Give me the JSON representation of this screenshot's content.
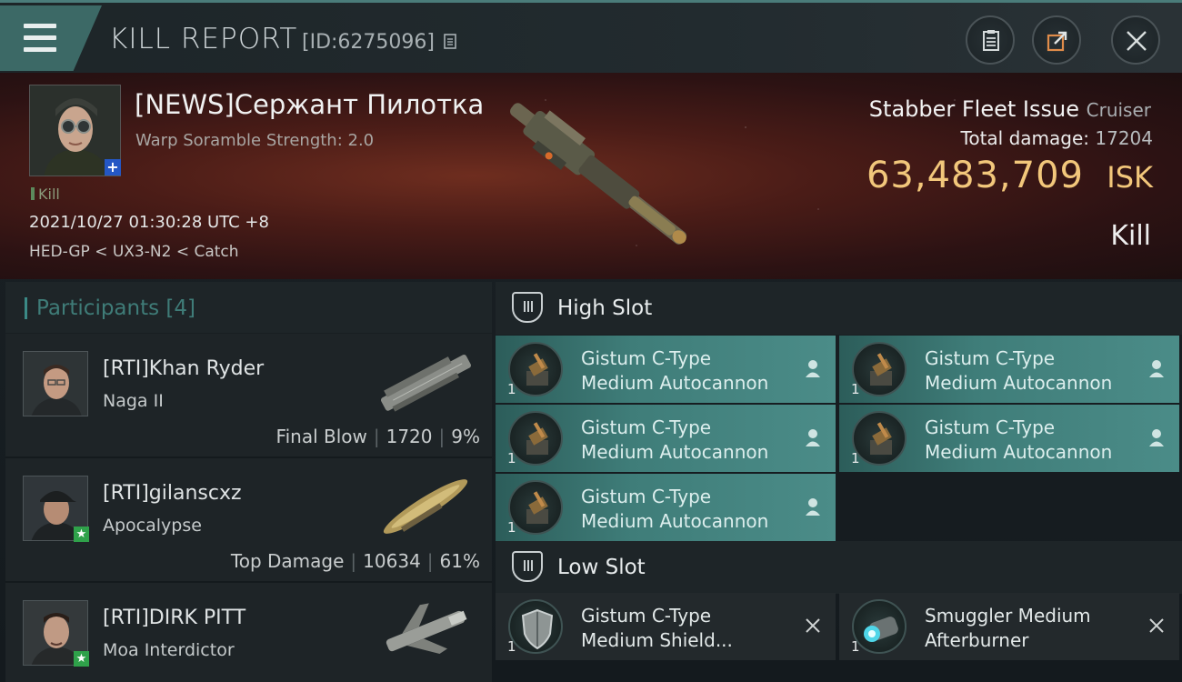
{
  "header": {
    "title": "KILL REPORT",
    "report_id": "[ID:6275096]"
  },
  "victim": {
    "name": "[NEWS]Сержант Пилотка",
    "warp_scramble": "Warp Soramble Strength: 2.0",
    "kill_tag": "Kill",
    "datetime": "2021/10/27 01:30:28 UTC +8",
    "location": "HED-GP < UX3-N2 < Catch",
    "ship_name": "Stabber Fleet Issue",
    "ship_class": "Cruiser",
    "total_damage_label": "Total damage:",
    "total_damage": "17204",
    "isk_value": "63,483,709",
    "isk_unit": "ISK",
    "result": "Kill"
  },
  "participants": {
    "title": "Participants",
    "count": "[4]",
    "rows": [
      {
        "name": "[RTI]Khan Ryder",
        "ship": "Naga II",
        "role": "Final Blow",
        "damage": "1720",
        "percent": "9%"
      },
      {
        "name": "[RTI]gilanscxz",
        "ship": "Apocalypse",
        "role": "Top Damage",
        "damage": "10634",
        "percent": "61%"
      },
      {
        "name": "[RTI]DIRK PITT",
        "ship": "Moa Interdictor",
        "role": "",
        "damage": "",
        "percent": ""
      }
    ]
  },
  "slots": {
    "high_title": "High Slot",
    "low_title": "Low Slot",
    "high_items": [
      {
        "line1": "Gistum C-Type",
        "line2": "Medium Autocannon",
        "qty": "1"
      },
      {
        "line1": "Gistum C-Type",
        "line2": "Medium Autocannon",
        "qty": "1"
      },
      {
        "line1": "Gistum C-Type",
        "line2": "Medium Autocannon",
        "qty": "1"
      },
      {
        "line1": "Gistum C-Type",
        "line2": "Medium Autocannon",
        "qty": "1"
      },
      {
        "line1": "Gistum C-Type",
        "line2": "Medium Autocannon",
        "qty": "1"
      }
    ],
    "low_items": [
      {
        "line1": "Gistum C-Type",
        "line2": "Medium Shield...",
        "qty": "1"
      },
      {
        "line1": "Smuggler Medium",
        "line2": "Afterburner",
        "qty": "1"
      }
    ]
  },
  "colors": {
    "accent_teal": "#3f7d79",
    "isk_gold": "#f2c77b",
    "banner_red": "#4a1c17"
  }
}
